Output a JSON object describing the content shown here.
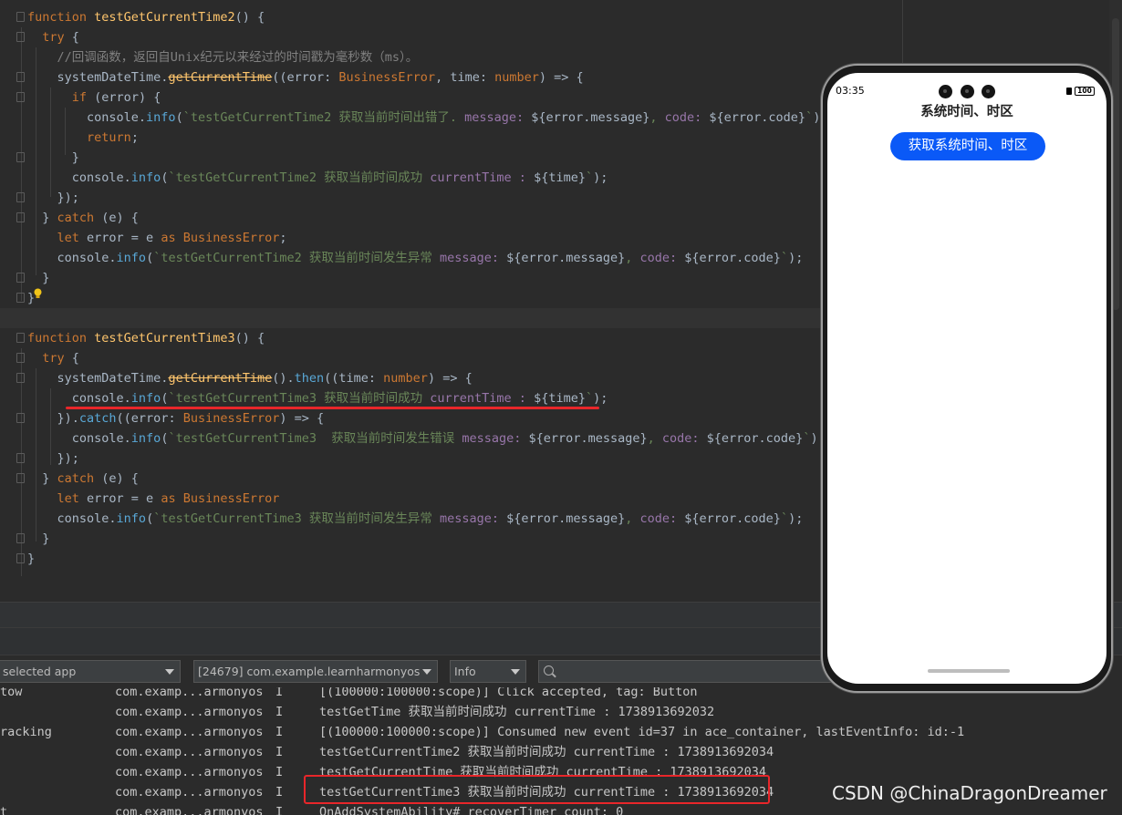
{
  "editor": {
    "lines": [
      [
        [
          "kw",
          "function "
        ],
        [
          "fn",
          "testGetCurrentTime2"
        ],
        [
          "pl",
          "() {"
        ]
      ],
      [
        [
          "pl",
          "  "
        ],
        [
          "kw",
          "try"
        ],
        [
          "pl",
          " {"
        ]
      ],
      [
        [
          "pl",
          "    "
        ],
        [
          "cm",
          "//回调函数，返回自Unix纪元以来经过的时间戳为毫秒数（ms）。"
        ]
      ],
      [
        [
          "pl",
          "    systemDateTime."
        ],
        [
          "dp",
          "getCurrentTime"
        ],
        [
          "pl",
          "((error: "
        ],
        [
          "ty",
          "BusinessError"
        ],
        [
          "pl",
          ", time: "
        ],
        [
          "ty",
          "number"
        ],
        [
          "pl",
          ") => {"
        ]
      ],
      [
        [
          "pl",
          "      "
        ],
        [
          "kw",
          "if"
        ],
        [
          "pl",
          " (error) {"
        ]
      ],
      [
        [
          "pl",
          "        console."
        ],
        [
          "mt",
          "info"
        ],
        [
          "pl",
          "("
        ],
        [
          "tp",
          "`testGetCurrentTime2 获取当前时间出错了. "
        ],
        [
          "pp",
          "message: "
        ],
        [
          "pl",
          "${error.message}"
        ],
        [
          "tp",
          ", "
        ],
        [
          "pp",
          "code: "
        ],
        [
          "pl",
          "${error.code}"
        ],
        [
          "tp",
          "`"
        ],
        [
          "pl",
          ");"
        ]
      ],
      [
        [
          "pl",
          "        "
        ],
        [
          "kw",
          "return"
        ],
        [
          "pl",
          ";"
        ]
      ],
      [
        [
          "pl",
          "      }"
        ]
      ],
      [
        [
          "pl",
          "      console."
        ],
        [
          "mt",
          "info"
        ],
        [
          "pl",
          "("
        ],
        [
          "tp",
          "`testGetCurrentTime2 获取当前时间成功 "
        ],
        [
          "pp",
          "currentTime : "
        ],
        [
          "pl",
          "${time}"
        ],
        [
          "tp",
          "`"
        ],
        [
          "pl",
          ");"
        ]
      ],
      [
        [
          "pl",
          "    });"
        ]
      ],
      [
        [
          "pl",
          "  } "
        ],
        [
          "kw",
          "catch"
        ],
        [
          "pl",
          " (e) {"
        ]
      ],
      [
        [
          "pl",
          "    "
        ],
        [
          "kw",
          "let"
        ],
        [
          "pl",
          " error = e "
        ],
        [
          "kw",
          "as "
        ],
        [
          "ty",
          "BusinessError"
        ],
        [
          "pl",
          ";"
        ]
      ],
      [
        [
          "pl",
          "    console."
        ],
        [
          "mt",
          "info"
        ],
        [
          "pl",
          "("
        ],
        [
          "tp",
          "`testGetCurrentTime2 获取当前时间发生异常 "
        ],
        [
          "pp",
          "message: "
        ],
        [
          "pl",
          "${error.message}"
        ],
        [
          "tp",
          ", "
        ],
        [
          "pp",
          "code: "
        ],
        [
          "pl",
          "${error.code}"
        ],
        [
          "tp",
          "`"
        ],
        [
          "pl",
          ");"
        ]
      ],
      [
        [
          "pl",
          "  }"
        ]
      ],
      [
        [
          "pl",
          "}"
        ]
      ],
      [
        [
          "pl",
          ""
        ]
      ],
      [
        [
          "kw",
          "function "
        ],
        [
          "fn",
          "testGetCurrentTime3"
        ],
        [
          "pl",
          "() {"
        ]
      ],
      [
        [
          "pl",
          "  "
        ],
        [
          "kw",
          "try"
        ],
        [
          "pl",
          " {"
        ]
      ],
      [
        [
          "pl",
          "    systemDateTime."
        ],
        [
          "dp",
          "getCurrentTime"
        ],
        [
          "pl",
          "()."
        ],
        [
          "mt",
          "then"
        ],
        [
          "pl",
          "((time: "
        ],
        [
          "ty",
          "number"
        ],
        [
          "pl",
          ") => {"
        ]
      ],
      [
        [
          "pl",
          "      console."
        ],
        [
          "mt",
          "info"
        ],
        [
          "pl",
          "("
        ],
        [
          "tp",
          "`testGetCurrentTime3 获取当前时间成功 "
        ],
        [
          "pp",
          "currentTime : "
        ],
        [
          "pl",
          "${time}"
        ],
        [
          "tp",
          "`"
        ],
        [
          "pl",
          ");"
        ]
      ],
      [
        [
          "pl",
          "    })."
        ],
        [
          "mt",
          "catch"
        ],
        [
          "pl",
          "((error: "
        ],
        [
          "ty",
          "BusinessError"
        ],
        [
          "pl",
          ") => {"
        ]
      ],
      [
        [
          "pl",
          "      console."
        ],
        [
          "mt",
          "info"
        ],
        [
          "pl",
          "("
        ],
        [
          "tp",
          "`testGetCurrentTime3  获取当前时间发生错误 "
        ],
        [
          "pp",
          "message: "
        ],
        [
          "pl",
          "${error.message}"
        ],
        [
          "tp",
          ", "
        ],
        [
          "pp",
          "code: "
        ],
        [
          "pl",
          "${error.code}"
        ],
        [
          "tp",
          "`"
        ],
        [
          "pl",
          ");"
        ]
      ],
      [
        [
          "pl",
          "    });"
        ]
      ],
      [
        [
          "pl",
          "  } "
        ],
        [
          "kw",
          "catch"
        ],
        [
          "pl",
          " (e) {"
        ]
      ],
      [
        [
          "pl",
          "    "
        ],
        [
          "kw",
          "let"
        ],
        [
          "pl",
          " error = e "
        ],
        [
          "kw",
          "as "
        ],
        [
          "ty",
          "BusinessError"
        ]
      ],
      [
        [
          "pl",
          "    console."
        ],
        [
          "mt",
          "info"
        ],
        [
          "pl",
          "("
        ],
        [
          "tp",
          "`testGetCurrentTime3 获取当前时间发生异常 "
        ],
        [
          "pp",
          "message: "
        ],
        [
          "pl",
          "${error.message}"
        ],
        [
          "tp",
          ", "
        ],
        [
          "pp",
          "code: "
        ],
        [
          "pl",
          "${error.code}"
        ],
        [
          "tp",
          "`"
        ],
        [
          "pl",
          ");"
        ]
      ],
      [
        [
          "pl",
          "  }"
        ]
      ],
      [
        [
          "pl",
          "}"
        ]
      ]
    ]
  },
  "toolbar": {
    "app_filter": "selected app",
    "process_filter": "[24679] com.example.learnharmonyos",
    "level_filter": "Info",
    "search_placeholder": ""
  },
  "logs": [
    {
      "tag": "tow",
      "pkg": "com.examp...armonyos",
      "level": "I",
      "msg": "[(100000:100000:scope)] Click accepted, tag: Button"
    },
    {
      "tag": "",
      "pkg": "com.examp...armonyos",
      "level": "I",
      "msg": "testGetTime 获取当前时间成功 currentTime : 1738913692032"
    },
    {
      "tag": "racking",
      "pkg": "com.examp...armonyos",
      "level": "I",
      "msg": "[(100000:100000:scope)] Consumed new event id=37 in ace_container, lastEventInfo: id:-1"
    },
    {
      "tag": "",
      "pkg": "com.examp...armonyos",
      "level": "I",
      "msg": "testGetCurrentTime2 获取当前时间成功 currentTime : 1738913692034"
    },
    {
      "tag": "",
      "pkg": "com.examp...armonyos",
      "level": "I",
      "msg": "testGetCurrentTime 获取当前时间成功 currentTime : 1738913692034"
    },
    {
      "tag": "",
      "pkg": "com.examp...armonyos",
      "level": "I",
      "msg": "testGetCurrentTime3 获取当前时间成功 currentTime : 1738913692034"
    },
    {
      "tag": "t",
      "pkg": "com.examp...armonyos",
      "level": "I",
      "msg": "OnAddSystemAbility# recoverTimer count: 0"
    }
  ],
  "phone": {
    "status_time": "03:35",
    "battery": "100",
    "title": "系统时间、时区",
    "button_label": "获取系统时间、时区"
  },
  "watermark": "CSDN @ChinaDragonDreamer",
  "colors": {
    "editor_bg": "#2b2b2b",
    "keyword": "#cc7832",
    "function": "#ffc66d",
    "string": "#6a8759",
    "accent_button": "#0a59f7",
    "highlight_red": "#e8262a"
  }
}
